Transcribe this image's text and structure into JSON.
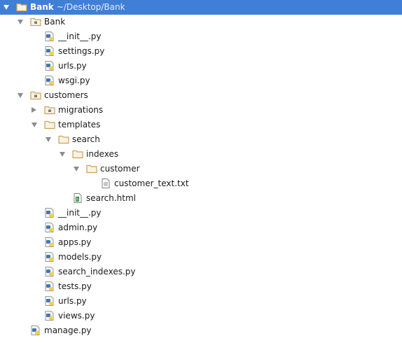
{
  "project": {
    "name": "Bank",
    "path": "~/Desktop/Bank"
  },
  "tree": [
    {
      "label": "Bank",
      "depth": 0,
      "type": "folder",
      "expanded": true,
      "selected": true,
      "bold": true
    },
    {
      "label": "Bank",
      "depth": 1,
      "type": "package",
      "expanded": true
    },
    {
      "label": "__init__.py",
      "depth": 2,
      "type": "python"
    },
    {
      "label": "settings.py",
      "depth": 2,
      "type": "python"
    },
    {
      "label": "urls.py",
      "depth": 2,
      "type": "python"
    },
    {
      "label": "wsgi.py",
      "depth": 2,
      "type": "python"
    },
    {
      "label": "customers",
      "depth": 1,
      "type": "package",
      "expanded": true
    },
    {
      "label": "migrations",
      "depth": 2,
      "type": "package",
      "expanded": false
    },
    {
      "label": "templates",
      "depth": 2,
      "type": "folder",
      "expanded": true
    },
    {
      "label": "search",
      "depth": 3,
      "type": "folder",
      "expanded": true
    },
    {
      "label": "indexes",
      "depth": 4,
      "type": "folder",
      "expanded": true
    },
    {
      "label": "customer",
      "depth": 5,
      "type": "folder",
      "expanded": true
    },
    {
      "label": "customer_text.txt",
      "depth": 6,
      "type": "text"
    },
    {
      "label": "search.html",
      "depth": 4,
      "type": "html"
    },
    {
      "label": "__init__.py",
      "depth": 2,
      "type": "python"
    },
    {
      "label": "admin.py",
      "depth": 2,
      "type": "python"
    },
    {
      "label": "apps.py",
      "depth": 2,
      "type": "python"
    },
    {
      "label": "models.py",
      "depth": 2,
      "type": "python"
    },
    {
      "label": "search_indexes.py",
      "depth": 2,
      "type": "python"
    },
    {
      "label": "tests.py",
      "depth": 2,
      "type": "python"
    },
    {
      "label": "urls.py",
      "depth": 2,
      "type": "python"
    },
    {
      "label": "views.py",
      "depth": 2,
      "type": "python"
    },
    {
      "label": "manage.py",
      "depth": 1,
      "type": "python"
    }
  ],
  "colors": {
    "selection": "#3f7fd6",
    "folder": "#c8a25c",
    "python_blue": "#3f78b5",
    "python_yellow": "#f5d04a"
  }
}
